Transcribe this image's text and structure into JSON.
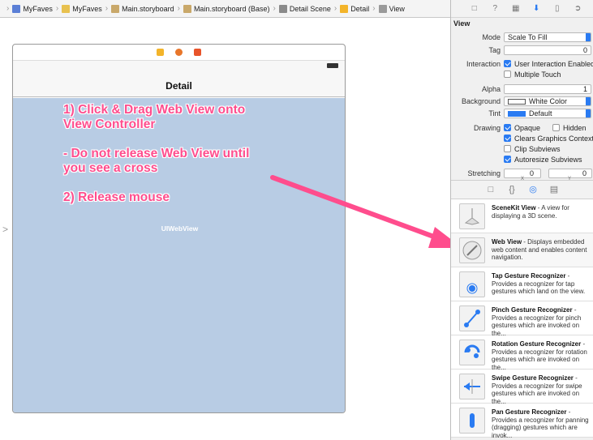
{
  "breadcrumb": [
    {
      "label": "MyFaves",
      "icon": "project-icon",
      "color": "#5b7fd6"
    },
    {
      "label": "MyFaves",
      "icon": "folder-icon",
      "color": "#e8c14f"
    },
    {
      "label": "Main.storyboard",
      "icon": "storyboard-icon",
      "color": "#c9a86a"
    },
    {
      "label": "Main.storyboard (Base)",
      "icon": "storyboard-icon",
      "color": "#c9a86a"
    },
    {
      "label": "Detail Scene",
      "icon": "scene-icon",
      "color": "#8a8a8a"
    },
    {
      "label": "Detail",
      "icon": "view-controller-icon",
      "color": "#f3b42a"
    },
    {
      "label": "View",
      "icon": "view-icon",
      "color": "#9a9a9a"
    }
  ],
  "scene": {
    "nav_title": "Detail",
    "webview_label": "UIWebView",
    "instructions": [
      "1) Click & Drag Web View onto",
      "View Controller",
      "- Do not release Web View until",
      "you see a cross",
      "2) Release mouse"
    ]
  },
  "inspector": {
    "section": "View",
    "mode_label": "Mode",
    "mode_value": "Scale To Fill",
    "tag_label": "Tag",
    "tag_value": "0",
    "interaction_label": "Interaction",
    "user_interaction": "User Interaction Enabled",
    "multiple_touch": "Multiple Touch",
    "alpha_label": "Alpha",
    "alpha_value": "1",
    "background_label": "Background",
    "background_value": "White Color",
    "tint_label": "Tint",
    "tint_value": "Default",
    "drawing_label": "Drawing",
    "opaque": "Opaque",
    "hidden": "Hidden",
    "clears": "Clears Graphics Context",
    "clip": "Clip Subviews",
    "autoresize": "Autoresize Subviews",
    "stretching_label": "Stretching",
    "stretch_x": "0",
    "stretch_y": "0",
    "stretch_x_label": "X",
    "stretch_y_label": "Y"
  },
  "library": [
    {
      "name": "SceneKit View",
      "text": " - A view for displaying a 3D scene.",
      "icon": "scenekit-icon"
    },
    {
      "name": "Web View",
      "text": " - Displays embedded web content and enables content navigation.",
      "icon": "compass-icon"
    },
    {
      "name": "Tap Gesture Recognizer",
      "text": " - Provides a recognizer for tap gestures which land on the view.",
      "icon": "tap-gesture-icon"
    },
    {
      "name": "Pinch Gesture Recognizer",
      "text": " - Provides a recognizer for pinch gestures which are invoked on the...",
      "icon": "pinch-gesture-icon"
    },
    {
      "name": "Rotation Gesture Recognizer",
      "text": " - Provides a recognizer for rotation gestures which are invoked on the...",
      "icon": "rotation-gesture-icon"
    },
    {
      "name": "Swipe Gesture Recognizer",
      "text": " - Provides a recognizer for swipe gestures which are invoked on the...",
      "icon": "swipe-gesture-icon"
    },
    {
      "name": "Pan Gesture Recognizer",
      "text": " - Provides a recognizer for panning (dragging) gestures which are invok...",
      "icon": "pan-gesture-icon"
    }
  ],
  "colors": {
    "annotation": "#ff4d8d",
    "accent": "#2a7bf2",
    "view_bg": "#b8cce4"
  }
}
